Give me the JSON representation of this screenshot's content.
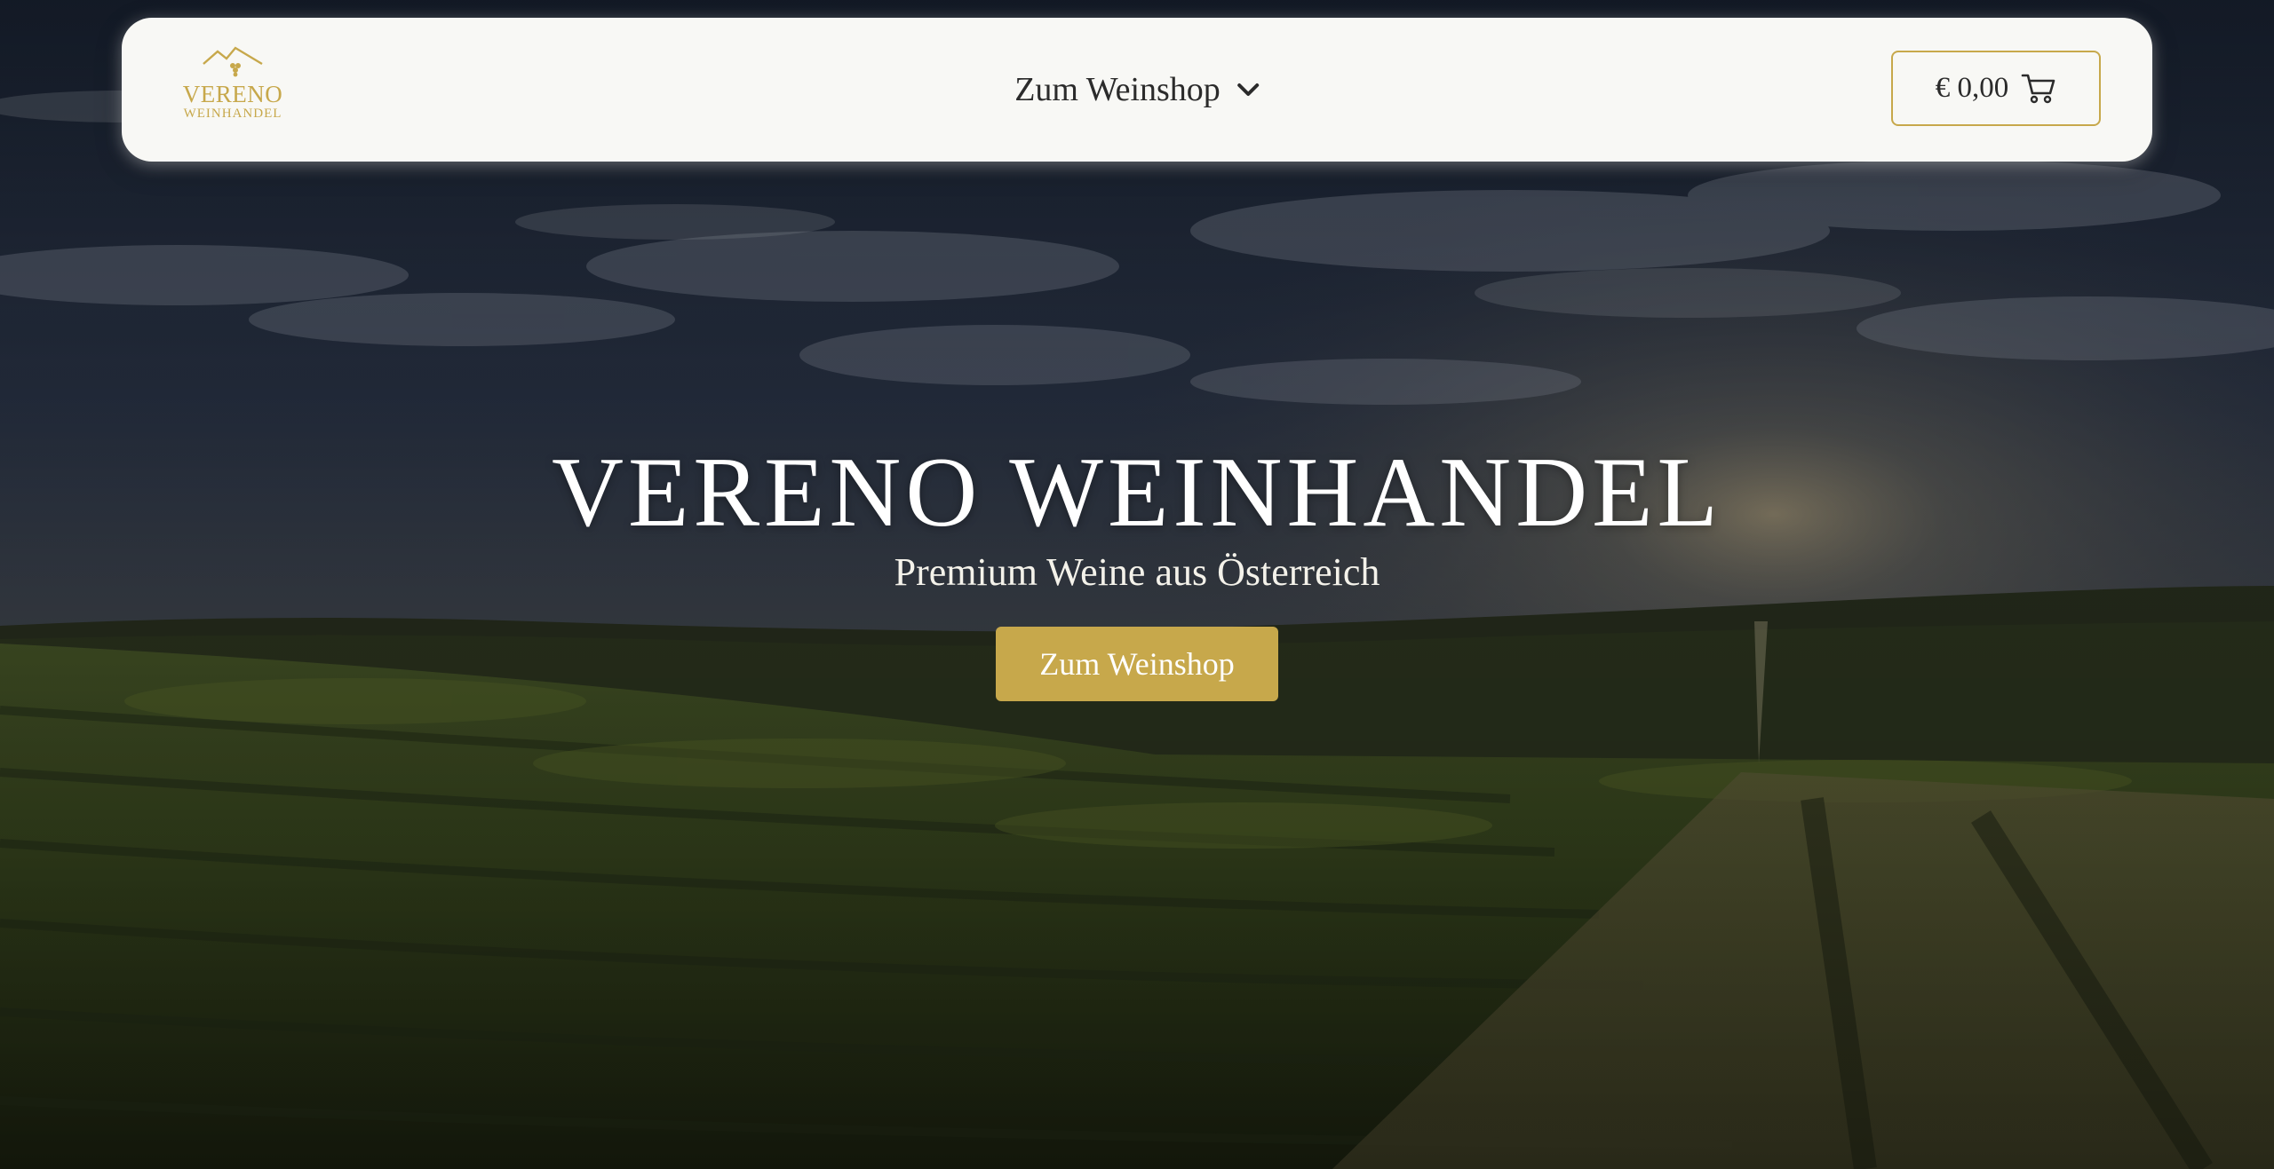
{
  "navbar": {
    "logo": {
      "brand": "VERENO",
      "sub": "WEINHANDEL"
    },
    "menu_label": "Zum Weinshop",
    "cart_amount": "€ 0,00"
  },
  "hero": {
    "title": "VERENO WEINHANDEL",
    "subtitle": "Premium Weine aus Österreich",
    "cta_label": "Zum Weinshop"
  },
  "icons": {
    "logo": "mountain-grape-icon",
    "menu": "chevron-down-icon",
    "cart": "shopping-cart-icon"
  },
  "colors": {
    "accent_gold": "#c7a84b",
    "navbar_bg": "#f8f8f5",
    "text_dark": "#2b2b2b",
    "hero_text": "#ffffff"
  }
}
